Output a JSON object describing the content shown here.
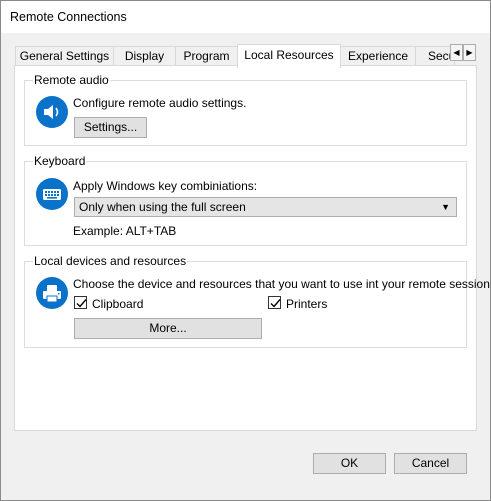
{
  "window": {
    "title": "Remote Connections"
  },
  "tabs": [
    {
      "label": "General Settings",
      "active": false
    },
    {
      "label": "Display",
      "active": false
    },
    {
      "label": "Program",
      "active": false
    },
    {
      "label": "Local Resources",
      "active": true
    },
    {
      "label": "Experience",
      "active": false
    },
    {
      "label": "Secu",
      "active": false
    }
  ],
  "tab_scroll": {
    "left": "◀",
    "right": "▶"
  },
  "remote_audio": {
    "group_label": "Remote audio",
    "icon": "speaker-icon",
    "description": "Configure remote audio settings.",
    "settings_button": "Settings..."
  },
  "keyboard": {
    "group_label": "Keyboard",
    "icon": "keyboard-icon",
    "description": "Apply Windows key combiniations:",
    "selected_option": "Only when using the full screen",
    "example": "Example: ALT+TAB"
  },
  "local_devices": {
    "group_label": "Local devices and resources",
    "icon": "printer-icon",
    "description": "Choose the device and resources that you want to use int your remote session.",
    "clipboard": {
      "label": "Clipboard",
      "checked": true
    },
    "printers": {
      "label": "Printers",
      "checked": true
    },
    "more_button": "More..."
  },
  "footer": {
    "ok": "OK",
    "cancel": "Cancel"
  },
  "colors": {
    "accent": "#0a72c9",
    "panel_bg": "#ffffff",
    "window_bg": "#f0f0f0"
  }
}
